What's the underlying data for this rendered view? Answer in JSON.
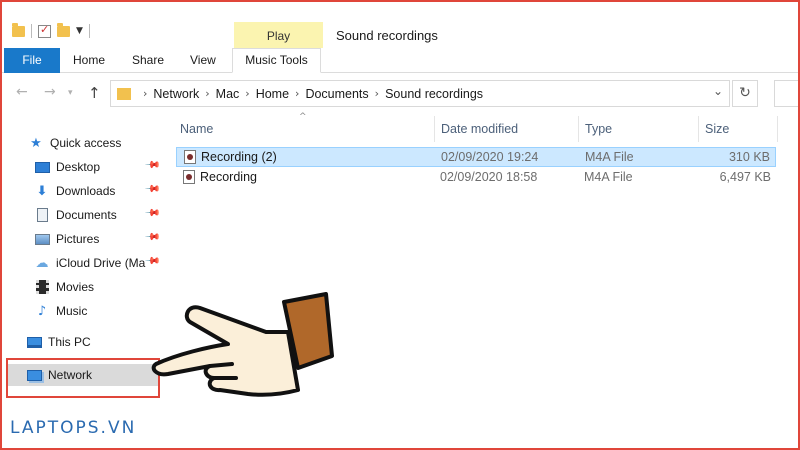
{
  "window": {
    "title": "Sound recordings"
  },
  "ribbon": {
    "context_group": "Play",
    "tabs": [
      {
        "label": "File"
      },
      {
        "label": "Home"
      },
      {
        "label": "Share"
      },
      {
        "label": "View"
      },
      {
        "label": "Music Tools"
      }
    ]
  },
  "address": {
    "crumbs": [
      "Network",
      "Mac",
      "Home",
      "Documents",
      "Sound recordings"
    ]
  },
  "nav": {
    "items": [
      {
        "label": "Quick access",
        "icon": "star-icon"
      },
      {
        "label": "Desktop",
        "icon": "desktop-icon",
        "pinned": true
      },
      {
        "label": "Downloads",
        "icon": "download-icon",
        "pinned": true
      },
      {
        "label": "Documents",
        "icon": "documents-icon",
        "pinned": true
      },
      {
        "label": "Pictures",
        "icon": "pictures-icon",
        "pinned": true
      },
      {
        "label": "iCloud Drive (Ma",
        "icon": "cloud-icon",
        "pinned": true
      },
      {
        "label": "Movies",
        "icon": "movies-icon"
      },
      {
        "label": "Music",
        "icon": "music-icon"
      },
      {
        "label": "This PC",
        "icon": "computer-icon"
      },
      {
        "label": "Network",
        "icon": "network-icon",
        "selected": true
      }
    ]
  },
  "files": {
    "columns": [
      "Name",
      "Date modified",
      "Type",
      "Size"
    ],
    "rows": [
      {
        "name": "Recording (2)",
        "date": "02/09/2020 19:24",
        "type": "M4A File",
        "size": "310 KB",
        "selected": true
      },
      {
        "name": "Recording",
        "date": "02/09/2020 18:58",
        "type": "M4A File",
        "size": "6,497 KB",
        "selected": false
      }
    ]
  },
  "watermark": "LAPTOPS.VN",
  "colors": {
    "accent": "#1979ca",
    "highlight_border": "#e0463a",
    "selection": "#cce8ff",
    "context_tab": "#fbf4b0"
  }
}
